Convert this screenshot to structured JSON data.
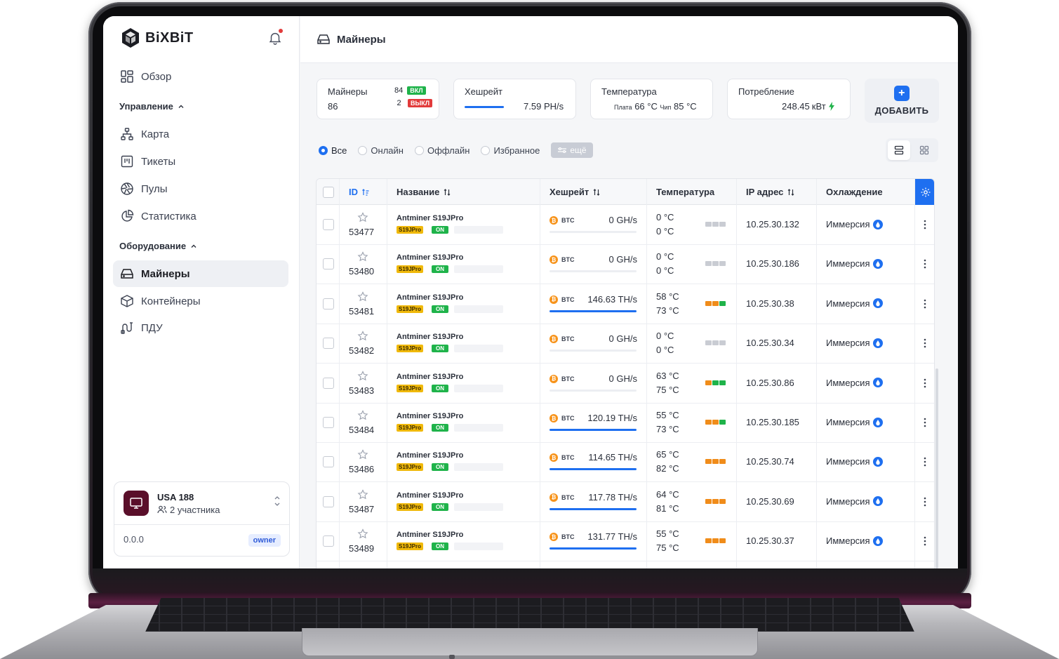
{
  "brand": {
    "name": "BiXBiT"
  },
  "sidebar": {
    "overview": "Обзор",
    "section_management": "Управление",
    "management_items": [
      {
        "label": "Карта",
        "icon": "map-icon"
      },
      {
        "label": "Тикеты",
        "icon": "tickets-icon"
      },
      {
        "label": "Пулы",
        "icon": "pools-icon"
      },
      {
        "label": "Статистика",
        "icon": "statistics-icon"
      }
    ],
    "section_equipment": "Оборудование",
    "equipment_items": [
      {
        "label": "Майнеры",
        "icon": "miner-icon",
        "active": true
      },
      {
        "label": "Контейнеры",
        "icon": "container-icon"
      },
      {
        "label": "ПДУ",
        "icon": "pdu-icon"
      }
    ],
    "team": {
      "name": "USA 188",
      "members": "2 участника",
      "version": "0.0.0",
      "role": "owner"
    }
  },
  "header": {
    "title": "Майнеры"
  },
  "stats": {
    "miners": {
      "title": "Майнеры",
      "total": "86",
      "on_count": "84",
      "on_label": "ВКЛ",
      "off_count": "2",
      "off_label": "ВЫКЛ"
    },
    "hashrate": {
      "title": "Хешрейт",
      "value": "7.59",
      "unit": "PH/s",
      "fill": 0.62
    },
    "temperature": {
      "title": "Температура",
      "board_label": "Плата",
      "board_value": "66 °C",
      "chip_label": "Чип",
      "chip_value": "85 °C"
    },
    "power": {
      "title": "Потребление",
      "value": "248.45",
      "unit": "кВт"
    },
    "add_label": "ДОБАВИТЬ"
  },
  "filters": {
    "options": [
      "Все",
      "Онлайн",
      "Оффлайн",
      "Избранное"
    ],
    "selected": "Все",
    "more_label": "ещё"
  },
  "table": {
    "columns": {
      "id": "ID",
      "name": "Название",
      "hashrate": "Хешрейт",
      "temperature": "Температура",
      "ip": "IP адрес",
      "cooling": "Охлаждение"
    },
    "rows": [
      {
        "id": "53477",
        "name": "Antminer S19JPro",
        "model": "S19JPro",
        "status": "ON",
        "coin": "BTC",
        "hash": "0",
        "hash_unit": "GH/s",
        "hash_fill": 0,
        "t1": "0 °C",
        "t2": "0 °C",
        "blocks": [
          "#c9ccd3",
          "#c9ccd3",
          "#c9ccd3"
        ],
        "ip": "10.25.30.132",
        "cooling": "Иммерсия"
      },
      {
        "id": "53480",
        "name": "Antminer S19JPro",
        "model": "S19JPro",
        "status": "ON",
        "coin": "BTC",
        "hash": "0",
        "hash_unit": "GH/s",
        "hash_fill": 0,
        "t1": "0 °C",
        "t2": "0 °C",
        "blocks": [
          "#c9ccd3",
          "#c9ccd3",
          "#c9ccd3"
        ],
        "ip": "10.25.30.186",
        "cooling": "Иммерсия"
      },
      {
        "id": "53481",
        "name": "Antminer S19JPro",
        "model": "S19JPro",
        "status": "ON",
        "coin": "BTC",
        "hash": "146.63",
        "hash_unit": "TH/s",
        "hash_fill": 1,
        "t1": "58 °C",
        "t2": "73 °C",
        "blocks": [
          "#f08c1a",
          "#f08c1a",
          "#1fb34a"
        ],
        "ip": "10.25.30.38",
        "cooling": "Иммерсия"
      },
      {
        "id": "53482",
        "name": "Antminer S19JPro",
        "model": "S19JPro",
        "status": "ON",
        "coin": "BTC",
        "hash": "0",
        "hash_unit": "GH/s",
        "hash_fill": 0,
        "t1": "0 °C",
        "t2": "0 °C",
        "blocks": [
          "#c9ccd3",
          "#c9ccd3",
          "#c9ccd3"
        ],
        "ip": "10.25.30.34",
        "cooling": "Иммерсия"
      },
      {
        "id": "53483",
        "name": "Antminer S19JPro",
        "model": "S19JPro",
        "status": "ON",
        "coin": "BTC",
        "hash": "0",
        "hash_unit": "GH/s",
        "hash_fill": 0,
        "t1": "63 °C",
        "t2": "75 °C",
        "blocks": [
          "#f08c1a",
          "#1fb34a",
          "#1fb34a"
        ],
        "ip": "10.25.30.86",
        "cooling": "Иммерсия"
      },
      {
        "id": "53484",
        "name": "Antminer S19JPro",
        "model": "S19JPro",
        "status": "ON",
        "coin": "BTC",
        "hash": "120.19",
        "hash_unit": "TH/s",
        "hash_fill": 1,
        "t1": "55 °C",
        "t2": "73 °C",
        "blocks": [
          "#f08c1a",
          "#f08c1a",
          "#1fb34a"
        ],
        "ip": "10.25.30.185",
        "cooling": "Иммерсия"
      },
      {
        "id": "53486",
        "name": "Antminer S19JPro",
        "model": "S19JPro",
        "status": "ON",
        "coin": "BTC",
        "hash": "114.65",
        "hash_unit": "TH/s",
        "hash_fill": 1,
        "t1": "65 °C",
        "t2": "82 °C",
        "blocks": [
          "#f08c1a",
          "#f08c1a",
          "#f08c1a"
        ],
        "ip": "10.25.30.74",
        "cooling": "Иммерсия"
      },
      {
        "id": "53487",
        "name": "Antminer S19JPro",
        "model": "S19JPro",
        "status": "ON",
        "coin": "BTC",
        "hash": "117.78",
        "hash_unit": "TH/s",
        "hash_fill": 1,
        "t1": "64 °C",
        "t2": "81 °C",
        "blocks": [
          "#f08c1a",
          "#f08c1a",
          "#f08c1a"
        ],
        "ip": "10.25.30.69",
        "cooling": "Иммерсия"
      },
      {
        "id": "53489",
        "name": "Antminer S19JPro",
        "model": "S19JPro",
        "status": "ON",
        "coin": "BTC",
        "hash": "131.77",
        "hash_unit": "TH/s",
        "hash_fill": 1,
        "t1": "55 °C",
        "t2": "75 °C",
        "blocks": [
          "#f08c1a",
          "#f08c1a",
          "#f08c1a"
        ],
        "ip": "10.25.30.37",
        "cooling": "Иммерсия"
      }
    ]
  },
  "colors": {
    "accent": "#1e6ff0",
    "on": "#1fb34a",
    "off": "#e23b3b",
    "btc": "#f7931a",
    "brand_avatar": "#5a0f2a"
  }
}
